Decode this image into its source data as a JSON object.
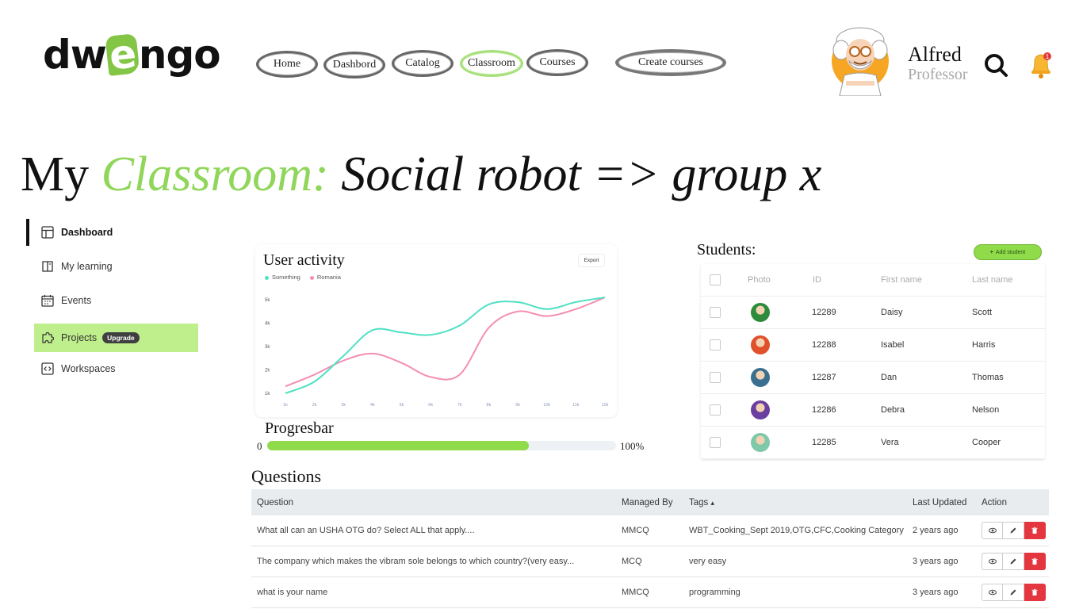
{
  "brand": {
    "logo_pre": "dw",
    "logo_e": "e",
    "logo_post": "ngo"
  },
  "nav": {
    "home": "Home",
    "dashboard": "Dashbord",
    "catalog": "Catalog",
    "classroom": "Classroom",
    "courses": "Courses",
    "create": "Create courses"
  },
  "user": {
    "name": "Alfred",
    "role": "Professor"
  },
  "notifications": {
    "count": "1"
  },
  "page_title": {
    "prefix": "My",
    "accent": "Classroom:",
    "rest": "Social robot => group x"
  },
  "sidebar": {
    "items": [
      {
        "label": "Dashboard",
        "icon": "layout-icon"
      },
      {
        "label": "My learning",
        "icon": "book-icon"
      },
      {
        "label": "Events",
        "icon": "calendar-icon"
      },
      {
        "label": "Projects",
        "icon": "puzzle-icon",
        "badge": "Upgrade"
      },
      {
        "label": "Workspaces",
        "icon": "code-icon"
      }
    ]
  },
  "activity": {
    "title": "User activity",
    "export_label": "Export",
    "legend": [
      {
        "name": "Something",
        "color": "#4fe0c4"
      },
      {
        "name": "Romania",
        "color": "#f48fb1"
      }
    ]
  },
  "chart_data": {
    "type": "line",
    "x": [
      "1k",
      "2k",
      "3k",
      "4k",
      "5k",
      "6k",
      "7k",
      "8k",
      "9k",
      "10k",
      "11k",
      "12k"
    ],
    "y_ticks": [
      "5k",
      "4k",
      "3k",
      "2k",
      "1k"
    ],
    "ylim": [
      1000,
      5000
    ],
    "series": [
      {
        "name": "Something",
        "color": "#4fe0c4",
        "values": [
          1000,
          1500,
          2600,
          3700,
          3600,
          3500,
          3900,
          4800,
          4900,
          4600,
          4900,
          5100
        ]
      },
      {
        "name": "Romania",
        "color": "#f48fb1",
        "values": [
          1300,
          1800,
          2400,
          2700,
          2300,
          1700,
          1800,
          3800,
          4500,
          4300,
          4600,
          5100
        ]
      }
    ]
  },
  "progress": {
    "title": "Progresbar",
    "min_label": "0",
    "max_label": "100%",
    "value": 0.75
  },
  "students": {
    "title": "Students:",
    "add_label": "Add student",
    "columns": {
      "photo": "Photo",
      "id": "ID",
      "first": "First name",
      "last": "Last name"
    },
    "rows": [
      {
        "id": "12289",
        "first": "Daisy",
        "last": "Scott",
        "color": "#2e8b3c"
      },
      {
        "id": "12288",
        "first": "Isabel",
        "last": "Harris",
        "color": "#e0502a"
      },
      {
        "id": "12287",
        "first": "Dan",
        "last": "Thomas",
        "color": "#3a6f8f"
      },
      {
        "id": "12286",
        "first": "Debra",
        "last": "Nelson",
        "color": "#6b3fa0"
      },
      {
        "id": "12285",
        "first": "Vera",
        "last": "Cooper",
        "color": "#7fc8a9"
      }
    ]
  },
  "questions": {
    "title": "Questions",
    "columns": {
      "question": "Question",
      "managed": "Managed By",
      "tags": "Tags",
      "sort_glyph": "▴",
      "updated": "Last Updated",
      "action": "Action"
    },
    "rows": [
      {
        "question": "What all can an USHA OTG do? Select ALL that apply....",
        "managed": "MMCQ",
        "tags": "WBT_Cooking_Sept 2019,OTG,CFC,Cooking Category",
        "updated": "2 years ago"
      },
      {
        "question": "The company which makes the vibram sole belongs to which country?(very easy...",
        "managed": "MCQ",
        "tags": "very easy",
        "updated": "3 years ago"
      },
      {
        "question": "what is your name",
        "managed": "MMCQ",
        "tags": "programming",
        "updated": "3 years ago"
      }
    ]
  }
}
